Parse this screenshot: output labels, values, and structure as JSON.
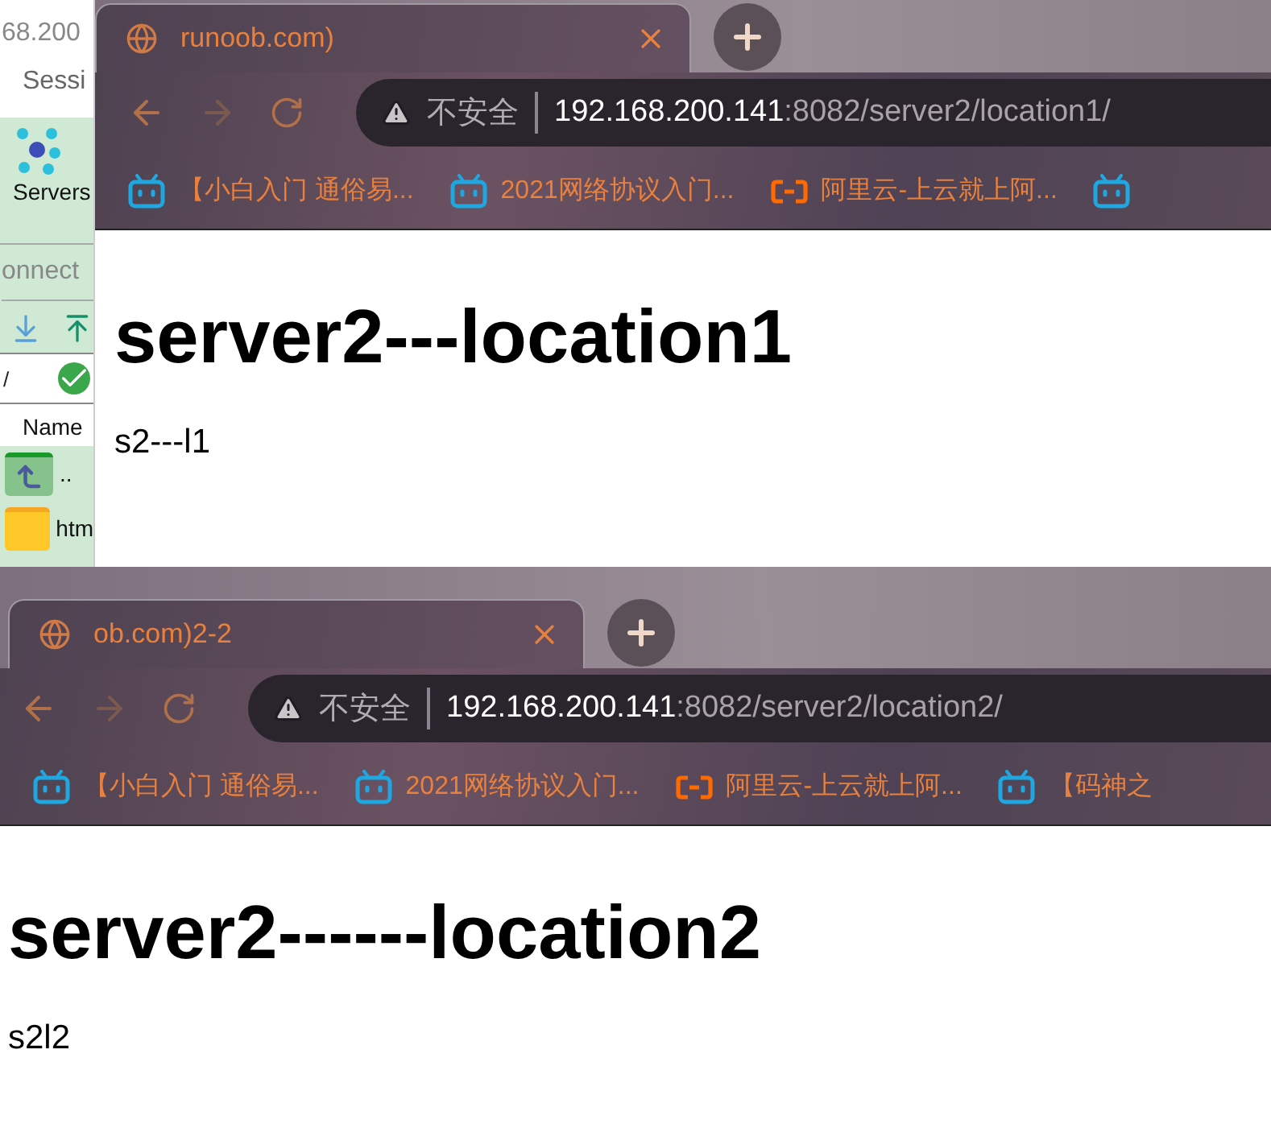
{
  "side_app": {
    "address_fragment": "68.200",
    "menu_item": "Sessi",
    "toolbar_label": "Servers",
    "connect_label": "onnect",
    "path_value": "/",
    "column_header": "Name",
    "files": [
      {
        "name": "..",
        "kind": "parent"
      },
      {
        "name": "htm",
        "kind": "folder"
      }
    ]
  },
  "browsers": [
    {
      "tab": {
        "title": "runoob.com)"
      },
      "address": {
        "security_label": "不安全",
        "host": "192.168.200.141",
        "path": ":8082/server2/location1/"
      },
      "bookmarks": [
        {
          "label": "【小白入门 通俗易...",
          "kind": "bilibili"
        },
        {
          "label": "2021网络协议入门...",
          "kind": "bilibili"
        },
        {
          "label": "阿里云-上云就上阿...",
          "kind": "aliyun"
        },
        {
          "kind": "bilibili"
        }
      ],
      "page": {
        "heading": "server2---location1",
        "paragraph": "s2---l1"
      }
    },
    {
      "tab": {
        "title": "ob.com)2-2"
      },
      "address": {
        "security_label": "不安全",
        "host": "192.168.200.141",
        "path": ":8082/server2/location2/"
      },
      "bookmarks": [
        {
          "label": "【小白入门 通俗易...",
          "kind": "bilibili"
        },
        {
          "label": "2021网络协议入门...",
          "kind": "bilibili"
        },
        {
          "label": "阿里云-上云就上阿...",
          "kind": "aliyun"
        },
        {
          "label": "【码神之",
          "kind": "bilibili"
        }
      ],
      "page": {
        "heading": "server2------location2",
        "paragraph": "s2l2"
      }
    }
  ]
}
